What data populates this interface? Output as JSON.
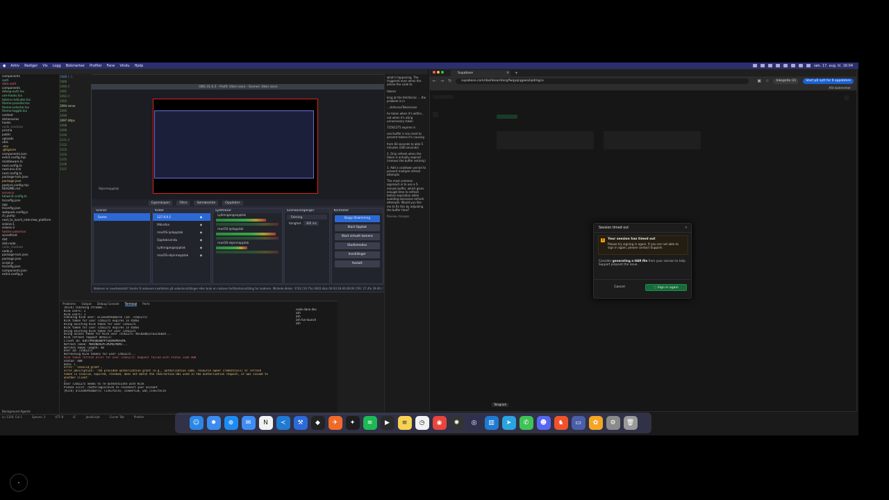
{
  "menubar": {
    "items": [
      "Arkiv",
      "Rediger",
      "Vis",
      "Logg",
      "Bokmerker",
      "Profiler",
      "Fane",
      "Vindu",
      "Hjelp"
    ],
    "clock": "søn. 17. aug. kl. 16:04"
  },
  "explorer": {
    "items": [
      {
        "label": "components",
        "color": "#c9c9c9"
      },
      {
        "label": "auth",
        "color": "#4ec9b0"
      },
      {
        "label": "data-auth",
        "color": "#e06c75"
      },
      {
        "label": "components",
        "color": "#c9c9c9"
      },
      {
        "label": "debug-auth.tsx",
        "color": "#73c991"
      },
      {
        "label": "use-hooks.tsx",
        "color": "#73c991"
      },
      {
        "label": "tokens-indicator.tsx",
        "color": "#73c991"
      },
      {
        "label": "theme-provider.tsx",
        "color": "#73c991"
      },
      {
        "label": "theme-selector.tsx",
        "color": "#73c991"
      },
      {
        "label": "theme-toggle.tsx",
        "color": "#73c991"
      },
      {
        "label": "context",
        "color": "#c9c9c9"
      },
      {
        "label": "dictionaries",
        "color": "#c9c9c9"
      },
      {
        "label": "hooks",
        "color": "#c9c9c9"
      },
      {
        "label": "node_modules",
        "color": "#777"
      },
      {
        "label": "prisma",
        "color": "#c9c9c9"
      },
      {
        "label": "public",
        "color": "#c9c9c9"
      },
      {
        "label": "uploads",
        "color": "#c9c9c9"
      },
      {
        "label": "utils",
        "color": "#c9c9c9"
      },
      {
        "label": ".env",
        "color": "#e5c07b"
      },
      {
        "label": ".gitignore",
        "color": "#e5c07b"
      },
      {
        "label": "components.json",
        "color": "#c9c9c9"
      },
      {
        "label": "eslint.config.mjs",
        "color": "#c9c9c9"
      },
      {
        "label": "middleware.ts",
        "color": "#c9c9c9"
      },
      {
        "label": "next.config.ts",
        "color": "#c9c9c9"
      },
      {
        "label": "next-env.d.ts",
        "color": "#c9c9c9"
      },
      {
        "label": "next.config.ts",
        "color": "#c9c9c9"
      },
      {
        "label": "package-lock.json",
        "color": "#c9c9c9"
      },
      {
        "label": "package.json",
        "color": "#e5c07b"
      },
      {
        "label": "postcss.config.mjs",
        "color": "#c9c9c9"
      },
      {
        "label": "README.md",
        "color": "#c9c9c9"
      },
      {
        "label": "server.js",
        "color": "#e06c75"
      },
      {
        "label": "tailwind.config.ts",
        "color": "#73c991"
      },
      {
        "label": "tsconfig.json",
        "color": "#c9c9c9"
      },
      {
        "label": "app",
        "color": "#c9c9c9"
      },
      {
        "label": "tsconfig.json",
        "color": "#c9c9c9"
      },
      {
        "label": "webpack.config.js",
        "color": "#c9c9c9"
      },
      {
        "label": "cli_pump",
        "color": "#c9c9c9"
      },
      {
        "label": "next_to_lunch_interview_platform",
        "color": "#c9c9c9"
      },
      {
        "label": "solana-1",
        "color": "#c9c9c9"
      },
      {
        "label": "solana-3",
        "color": "#c9c9c9"
      },
      {
        "label": "twitter-pokemon",
        "color": "#e06c75"
      },
      {
        "label": "socialfront",
        "color": "#c9c9c9"
      },
      {
        "label": "dist",
        "color": "#c9c9c9"
      },
      {
        "label": "dist-node",
        "color": "#c9c9c9"
      },
      {
        "label": "node_modules",
        "color": "#777"
      },
      {
        "label": "node.js",
        "color": "#c9c9c9"
      },
      {
        "label": "package-lock.json",
        "color": "#c9c9c9"
      },
      {
        "label": "package.json",
        "color": "#c9c9c9"
      },
      {
        "label": "script.js",
        "color": "#c9c9c9"
      },
      {
        "label": "tsconfig.json",
        "color": "#c9c9c9"
      },
      {
        "label": "components.json",
        "color": "#c9c9c9"
      },
      {
        "label": "eslint.config.js",
        "color": "#c9c9c9"
      }
    ],
    "footer": "Background Agents"
  },
  "obs": {
    "title": "OBS 31.0.3 - Profil: Uten navn - Scener: Uten navn",
    "source_label": "Skjermopptak",
    "scene_tabs": [
      "Egenskaper",
      "Filtre",
      "Sømløsslide",
      "Oppdater"
    ],
    "scenes": {
      "title": "Scener",
      "items": [
        "Scene"
      ]
    },
    "sources": {
      "title": "Kilder",
      "items": [
        "127.0.0.1",
        "Mikrofon",
        "macOS-lydopptak",
        "Opptaksvindu",
        "Lydinngangsopptak",
        "macOS-skjermopptak"
      ]
    },
    "mixer": {
      "title": "Lydmikser",
      "channels": [
        {
          "name": "Lydinngangsopptak",
          "level": 0.8
        },
        {
          "name": "macOS-lydopptak",
          "level": 0.95
        },
        {
          "name": "macOS-skjermopptak",
          "level": 0.5
        }
      ]
    },
    "transitions": {
      "title": "Sceneoverganger",
      "type": "Falming",
      "duration_label": "Varighet",
      "duration": "300 ms"
    },
    "controls": {
      "title": "Kontroller",
      "buttons": [
        "Stopp Strømming",
        "Start Opptak",
        "Start virtuelt kamera",
        "Studiomodus",
        "Innstillinger",
        "Avslutt"
      ]
    },
    "status": "Koderen er overbelastet! Vurder å redusere kvaliteten på videoinnstillinger eller bruk en raskere forhåndsinnstilling for koderen.   Mistede bilder: 3742 (19.7%)   4603 kb/s   00:03:28   00:00:00   CPU: 27.4%   29.00 / 30.00 FPS"
  },
  "terminal": {
    "tabs": [
      "Problems",
      "Output",
      "Debug Console",
      "Terminal",
      "Ports"
    ],
    "lines": [
      {
        "t": "[Kick] Checking streams...",
        "c": "#c9c9c9"
      },
      {
        "t": "  Kick users: 2",
        "c": "#c9c9c9"
      },
      {
        "t": "  Kick users: 1",
        "c": "#c9c9c9"
      },
      {
        "t": "  Checking Kick user: aliasdotkamarcn (ID: 72561275)",
        "c": "#c9c9c9"
      },
      {
        "t": "  Kick token for user 72561275 expires in 4546s",
        "c": "#c9c9c9"
      },
      {
        "t": "  Using existing Kick token for user 72561275",
        "c": "#c9c9c9"
      },
      {
        "t": "  Kick token for user 72561275 expires in 4546s",
        "c": "#c9c9c9"
      },
      {
        "t": "  Using existing Kick token for user 72561275",
        "c": "#c9c9c9"
      },
      {
        "t": "  Using access token for Kick user 72561275: NJC0ZDQ2ZTEZZJE0ZA...",
        "c": "#c9c9c9"
      },
      {
        "t": "  Kick refresh request details:",
        "c": "#c9c9c9"
      },
      {
        "t": "    Client ID: 01K5YMVQ0Q80PPYEQ8H4M8A3ME",
        "c": "#c9c9c9"
      },
      {
        "t": "    Refresh Token: MDA4NDRLMTJMZMQTMDM2...",
        "c": "#c9c9c9"
      },
      {
        "t": "    Refresh token length: 48",
        "c": "#c9c9c9"
      },
      {
        "t": "    User ID: 72561275",
        "c": "#c9c9c9"
      },
      {
        "t": "  Refreshing Kick tokens for user 72561275...",
        "c": "#c9c9c9"
      },
      {
        "t": "  Kick token refresh error for user 72561275: Request failed with status code 400",
        "c": "#e06c75"
      },
      {
        "t": "  Status: 400",
        "c": "#c9c9c9"
      },
      {
        "t": "  Data: {",
        "c": "#c9c9c9"
      },
      {
        "t": "    error: 'invalid_grant',",
        "c": "#e5c07b"
      },
      {
        "t": "    error_description: 'The provided authorization grant (e.g., authorization code, resource owner credentials) or refresh",
        "c": "#e5c07b"
      },
      {
        "t": "  token is invalid, expired, revoked, does not match the redirection URI used in the authorization request, or was issued to",
        "c": "#e5c07b"
      },
      {
        "t": "  another client'",
        "c": "#e5c07b"
      },
      {
        "t": "  }",
        "c": "#c9c9c9"
      },
      {
        "t": "  User 72561275 needs to re-authenticate with Kick",
        "c": "#c9c9c9"
      },
      {
        "t": "  Please visit: /auth/login/kick to reconnect your account",
        "c": "#c9c9c9"
      },
      {
        "t": "  [Kick] aliasdotkamarcn: live=false, viewers=0, was_live=false",
        "c": "#c9c9c9"
      }
    ],
    "side": [
      "node dane dev",
      "zsh",
      "zsh",
      "zsh  fun-launch",
      "zsh"
    ]
  },
  "chat": {
    "paragraphs": [
      "what's happening. The triggered even when the amine the code to",
      "tokens",
      "king at the fetchkickc ... the problem is in",
      "...ckAccessToken(user",
      "he token when it's within , not when it's ating unnecessary token",
      "72561275 expires in",
      "ssal buffer is too reset to prevent tokens it's causing",
      "from 60 seconds to able 5 minutes (300 seconds)",
      "2. Only refresh when the token is actually expired (remove the buffer entirely)",
      "3. Add a cooldown period to prevent multiple refresh attempts",
      "The most common approach is to use a 5-minute buffer, which gives enough time to refresh before expiration while avoiding excessive refresh attempts. Would you like me to fix this by adjusting the buffer time?"
    ],
    "review": "Review changes"
  },
  "vs_status": [
    "Ln 1319, Col 1",
    "Spaces: 2",
    "UTF-8",
    "LF",
    "JavaScript",
    "Cursor Tab",
    "Prettier"
  ],
  "browser": {
    "tab_title": "Supabase",
    "url": "supabase.com/dashboard/org/fwqyqngpwazipdmgco",
    "incognito": "Inkognito (2)",
    "upgrade": "Start på nytt for å oppdatere",
    "bookmarks": "Alle bokmerker",
    "modal": {
      "title": "Session timed out",
      "warning_title": "Your session has timed out",
      "warning_text": "Please try signing in again. If you are not able to sign in again, please contact Support.",
      "consider_prefix": "Consider ",
      "consider_bold": "generating a HAR file",
      "consider_suffix": " from your session to help Support pinpoint the issue.",
      "cancel": "Cancel",
      "signin": "Sign in again"
    }
  },
  "tooltip": "Telegram",
  "dock": {
    "apps": [
      {
        "name": "finder-icon",
        "glyph": "☺",
        "color": "#2a86e8"
      },
      {
        "name": "settings-icon",
        "glyph": "✹",
        "color": "#3b8bf0"
      },
      {
        "name": "safari-icon",
        "glyph": "⊕",
        "color": "#1d8cf2"
      },
      {
        "name": "mail-icon",
        "glyph": "✉",
        "color": "#3d8df5"
      },
      {
        "name": "notion-icon",
        "glyph": "N",
        "color": "#f1f1f1"
      },
      {
        "name": "vscode-icon",
        "glyph": "≺",
        "color": "#1f7ad4"
      },
      {
        "name": "xcode-icon",
        "glyph": "⚒",
        "color": "#2b6bd8"
      },
      {
        "name": "cursor-icon",
        "glyph": "◆",
        "color": "#222"
      },
      {
        "name": "postman-icon",
        "glyph": "✈",
        "color": "#f06a2b"
      },
      {
        "name": "figma-icon",
        "glyph": "✦",
        "color": "#1d1d1d"
      },
      {
        "name": "spotify-icon",
        "glyph": "≋",
        "color": "#1db954"
      },
      {
        "name": "terminal-icon",
        "glyph": "▶",
        "color": "#2a2a2a"
      },
      {
        "name": "notes-icon",
        "glyph": "≡",
        "color": "#f7d254"
      },
      {
        "name": "clock-icon",
        "glyph": "◷",
        "color": "#f1f1f1"
      },
      {
        "name": "chrome-icon",
        "glyph": "◉",
        "color": "#e8453c"
      },
      {
        "name": "chatgpt-icon",
        "glyph": "✺",
        "color": "#333"
      },
      {
        "name": "obs-icon",
        "glyph": "◎",
        "color": "#2f2f4f"
      },
      {
        "name": "trello-icon",
        "glyph": "▥",
        "color": "#1f7ad4"
      },
      {
        "name": "telegram-icon",
        "glyph": "➤",
        "color": "#2aa4e0"
      },
      {
        "name": "messages-icon",
        "glyph": "✆",
        "color": "#3fc356"
      },
      {
        "name": "discord-icon",
        "glyph": "☻",
        "color": "#5865f2"
      },
      {
        "name": "brave-icon",
        "glyph": "♞",
        "color": "#f0532b"
      },
      {
        "name": "finder-window-icon",
        "glyph": "▭",
        "color": "#4a5fa8"
      },
      {
        "name": "photos-icon",
        "glyph": "✿",
        "color": "#f5a524"
      },
      {
        "name": "system-preferences-icon",
        "glyph": "⚙",
        "color": "#8a8a8a"
      },
      {
        "name": "trash-icon",
        "glyph": "🗑",
        "color": "#9a9a9a"
      }
    ]
  }
}
